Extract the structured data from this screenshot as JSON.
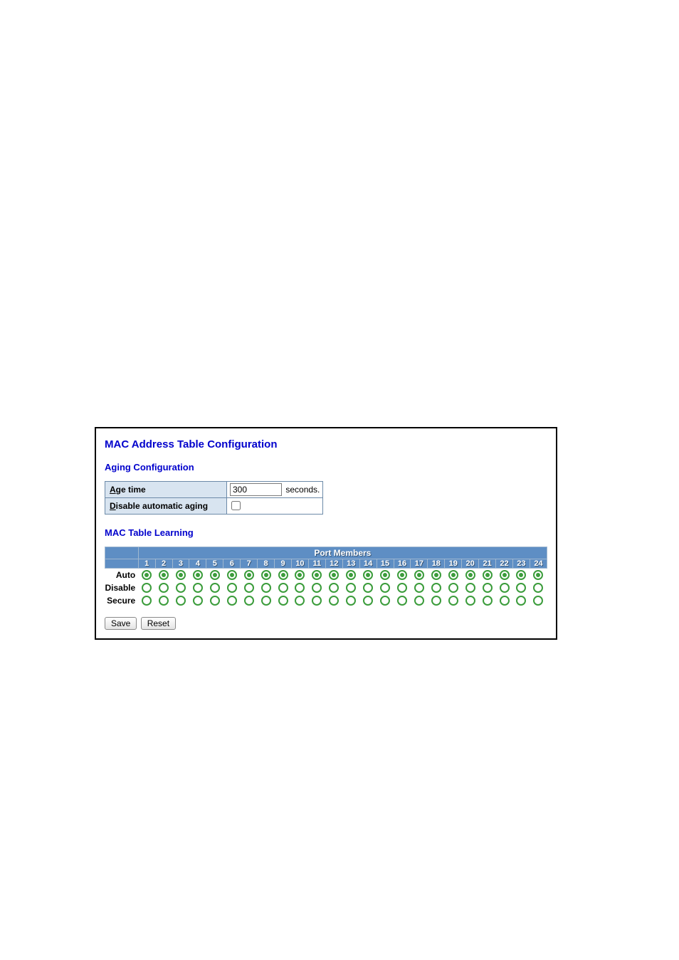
{
  "title": "MAC Address Table Configuration",
  "aging": {
    "heading": "Aging Configuration",
    "age_time_label_pre": "A",
    "age_time_label_post": "ge time",
    "age_time_value": "300",
    "seconds_label": "seconds.",
    "disable_aging_label_pre": "D",
    "disable_aging_label_post": "isable automatic aging",
    "disable_aging_checked": false
  },
  "learning": {
    "heading": "MAC Table Learning",
    "port_members_label": "Port Members",
    "ports": [
      "1",
      "2",
      "3",
      "4",
      "5",
      "6",
      "7",
      "8",
      "9",
      "10",
      "11",
      "12",
      "13",
      "14",
      "15",
      "16",
      "17",
      "18",
      "19",
      "20",
      "21",
      "22",
      "23",
      "24"
    ],
    "rows": [
      {
        "label": "Auto",
        "selected": true
      },
      {
        "label": "Disable",
        "selected": false
      },
      {
        "label": "Secure",
        "selected": false
      }
    ]
  },
  "buttons": {
    "save": "Save",
    "reset": "Reset"
  }
}
